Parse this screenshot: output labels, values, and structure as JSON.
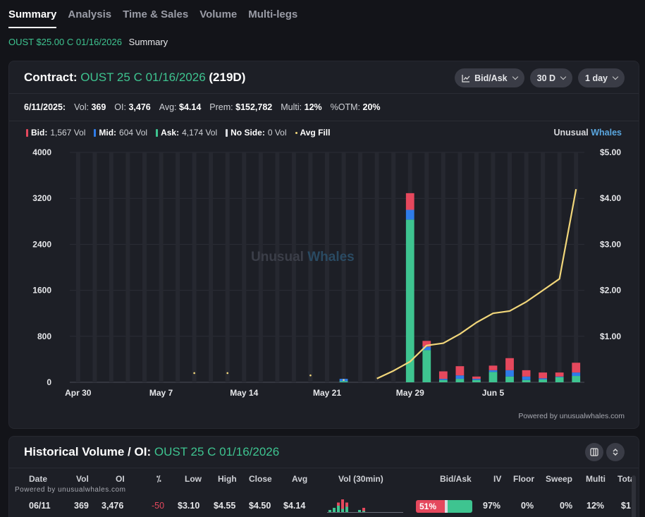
{
  "tabs": [
    "Summary",
    "Analysis",
    "Time & Sales",
    "Volume",
    "Multi-legs"
  ],
  "active_tab": "Summary",
  "subhead": {
    "symbol": "OUST $25.00 C 01/16/2026",
    "label": "Summary"
  },
  "contract": {
    "label": "Contract:",
    "symbol": "OUST 25 C 01/16/2026",
    "dte": "(219D)",
    "controls": {
      "mode": "Bid/Ask",
      "range": "30 D",
      "interval": "1 day"
    }
  },
  "stats": {
    "date": "6/11/2025:",
    "vol_label": "Vol:",
    "vol": "369",
    "oi_label": "OI:",
    "oi": "3,476",
    "avg_label": "Avg:",
    "avg": "$4.14",
    "prem_label": "Prem:",
    "prem": "$152,782",
    "multi_label": "Multi:",
    "multi": "12%",
    "otm_label": "%OTM:",
    "otm": "20%"
  },
  "legend": {
    "bid_label": "Bid:",
    "bid": "1,567 Vol",
    "mid_label": "Mid:",
    "mid": "604 Vol",
    "ask_label": "Ask:",
    "ask": "4,174 Vol",
    "noside_label": "No Side:",
    "noside": "0 Vol",
    "avgfill": "Avg Fill"
  },
  "brand": {
    "a": "Unusual",
    "b": "Whales"
  },
  "watermark": {
    "a": "Unusual",
    "b": "Whales"
  },
  "powered": "Powered by unusualwhales.com",
  "colors": {
    "bid": "#e5485d",
    "mid": "#2f7ce8",
    "ask": "#3ec490",
    "avg_fill": "#f1d67a",
    "accent": "#3ec490"
  },
  "chart_data": {
    "type": "bar",
    "x_tick_labels": [
      "Apr 30",
      "May 7",
      "May 14",
      "May 21",
      "May 29",
      "Jun 5"
    ],
    "ylim_left": [
      0,
      4000
    ],
    "yticks_left": [
      "4000",
      "3200",
      "2400",
      "1600",
      "800",
      "0"
    ],
    "ylim_right": [
      0,
      5
    ],
    "yticks_right": [
      "$5.00",
      "$4.00",
      "$3.00",
      "$2.00",
      "$1.00"
    ],
    "bars": [
      {
        "ask": 0,
        "mid": 0,
        "bid": 0,
        "avg": null
      },
      {
        "ask": 0,
        "mid": 0,
        "bid": 0,
        "avg": null
      },
      {
        "ask": 0,
        "mid": 0,
        "bid": 0,
        "avg": null
      },
      {
        "ask": 0,
        "mid": 0,
        "bid": 0,
        "avg": null
      },
      {
        "ask": 0,
        "mid": 0,
        "bid": 0,
        "avg": null
      },
      {
        "ask": 0,
        "mid": 0,
        "bid": 0,
        "avg": null
      },
      {
        "ask": 0,
        "mid": 0,
        "bid": 0,
        "avg": null
      },
      {
        "ask": 0,
        "mid": 0,
        "bid": 0,
        "avg": 0.2
      },
      {
        "ask": 0,
        "mid": 0,
        "bid": 0,
        "avg": null
      },
      {
        "ask": 0,
        "mid": 0,
        "bid": 0,
        "avg": 0.2
      },
      {
        "ask": 0,
        "mid": 0,
        "bid": 0,
        "avg": null
      },
      {
        "ask": 0,
        "mid": 0,
        "bid": 0,
        "avg": null
      },
      {
        "ask": 0,
        "mid": 0,
        "bid": 0,
        "avg": null
      },
      {
        "ask": 0,
        "mid": 0,
        "bid": 0,
        "avg": null
      },
      {
        "ask": 0,
        "mid": 0,
        "bid": 0,
        "avg": 0.15
      },
      {
        "ask": 0,
        "mid": 0,
        "bid": 0,
        "avg": null
      },
      {
        "ask": 20,
        "mid": 40,
        "bid": 0,
        "avg": 0.05
      },
      {
        "ask": 0,
        "mid": 0,
        "bid": 0,
        "avg": null
      },
      {
        "ask": 0,
        "mid": 0,
        "bid": 0,
        "avg": 0.08
      },
      {
        "ask": 0,
        "mid": 0,
        "bid": 0,
        "avg": 0.25
      },
      {
        "ask": 2830,
        "mid": 170,
        "bid": 290,
        "avg": 0.45
      },
      {
        "ask": 560,
        "mid": 60,
        "bid": 100,
        "avg": 0.8
      },
      {
        "ask": 40,
        "mid": 20,
        "bid": 130,
        "avg": 0.85
      },
      {
        "ask": 60,
        "mid": 60,
        "bid": 160,
        "avg": 1.05
      },
      {
        "ask": 40,
        "mid": 20,
        "bid": 40,
        "avg": 1.3
      },
      {
        "ask": 180,
        "mid": 30,
        "bid": 80,
        "avg": 1.5
      },
      {
        "ask": 100,
        "mid": 110,
        "bid": 210,
        "avg": 1.55
      },
      {
        "ask": 40,
        "mid": 60,
        "bid": 110,
        "avg": 1.75
      },
      {
        "ask": 50,
        "mid": 20,
        "bid": 100,
        "avg": 2.0
      },
      {
        "ask": 90,
        "mid": 10,
        "bid": 70,
        "avg": 2.25
      },
      {
        "ask": 110,
        "mid": 60,
        "bid": 170,
        "avg": 4.2
      }
    ]
  },
  "historical": {
    "title": "Historical Volume / OI:",
    "symbol": "OUST 25 C 01/16/2026",
    "headers": [
      "Date",
      "Vol",
      "OI",
      "⁒",
      "Low",
      "High",
      "Close",
      "Avg",
      "Vol (30min)",
      "Bid/Ask",
      "IV",
      "Floor",
      "Sweep",
      "Multi",
      "Tota"
    ],
    "row": {
      "date": "06/11",
      "vol": "369",
      "oi": "3,476",
      "oi_change": "-50",
      "low": "$3.10",
      "high": "$4.55",
      "close": "$4.50",
      "avg": "$4.14",
      "bidask": "51%",
      "bid_share": 51,
      "mid_share": 5,
      "iv": "97%",
      "floor": "0%",
      "sweep": "0%",
      "multi": "12%",
      "total": "$1"
    },
    "vol30_bars": [
      {
        "ask": 2,
        "bid": 0
      },
      {
        "ask": 4,
        "bid": 0
      },
      {
        "ask": 6,
        "bid": 3
      },
      {
        "ask": 3,
        "bid": 9
      },
      {
        "ask": 5,
        "bid": 4
      },
      {
        "ask": 0,
        "bid": 0
      },
      {
        "ask": 0,
        "bid": 0
      },
      {
        "ask": 2,
        "bid": 0
      },
      {
        "ask": 1,
        "bid": 3
      },
      {
        "ask": 0,
        "bid": 0
      },
      {
        "ask": 0,
        "bid": 0
      },
      {
        "ask": 0,
        "bid": 0
      },
      {
        "ask": 0,
        "bid": 0
      },
      {
        "ask": 0,
        "bid": 0
      },
      {
        "ask": 0,
        "bid": 0
      }
    ],
    "powered": "Powered by unusualwhales.com"
  }
}
